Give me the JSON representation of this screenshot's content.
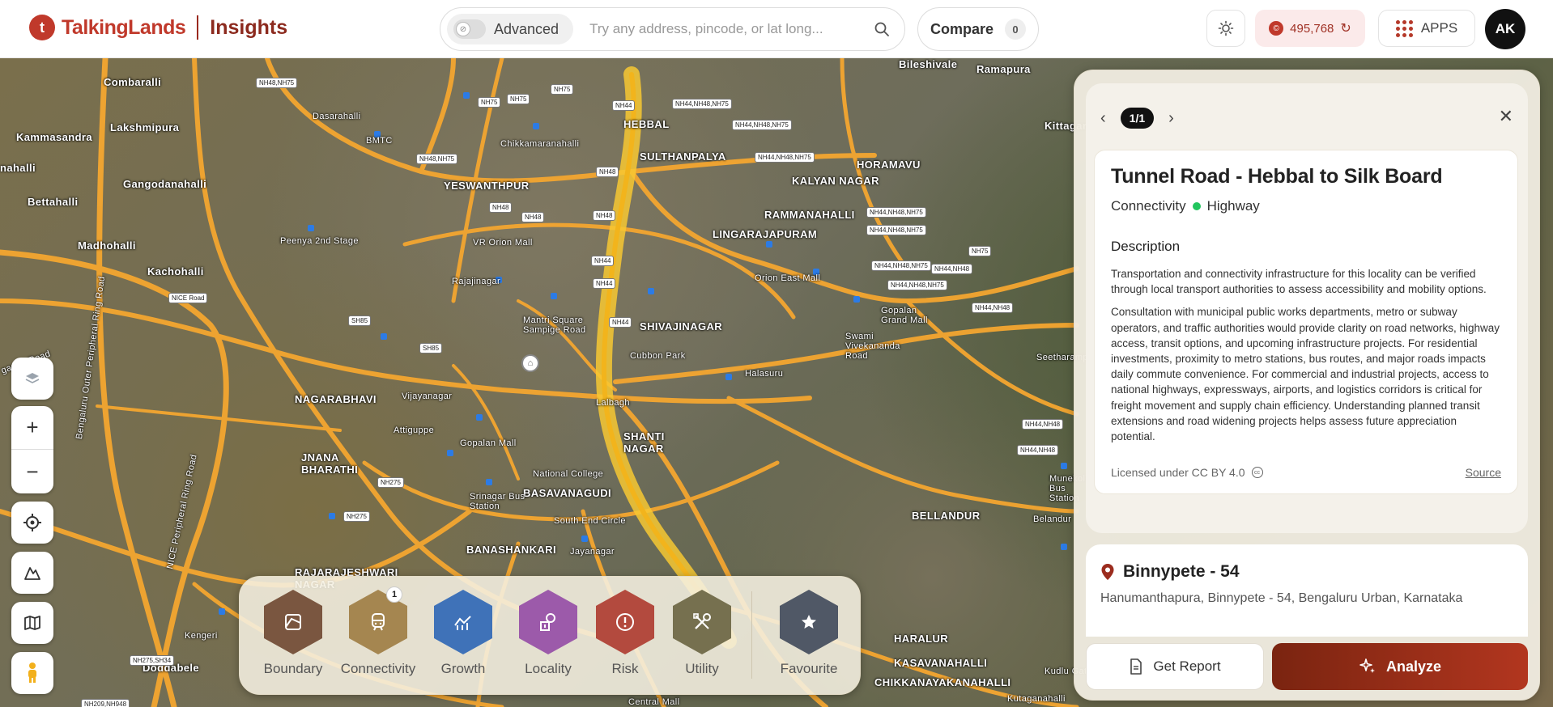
{
  "header": {
    "logo_mark": "t",
    "logo_text": "TalkingLands",
    "logo_sub": "Insights",
    "advanced_label": "Advanced",
    "search_placeholder": "Try any address, pincode, or lat long...",
    "compare_label": "Compare",
    "compare_count": "0",
    "credits_value": "495,768",
    "apps_label": "APPS",
    "avatar_initials": "AK"
  },
  "colors": {
    "brand": "#c0392b",
    "road": "#f4a630",
    "highlight": "#f7c832",
    "analyze": "#a5321c"
  },
  "map": {
    "places": [
      {
        "name": "Combaralli"
      },
      {
        "name": "Lakshmipura"
      },
      {
        "name": "Kammasandra"
      },
      {
        "name": "nahalli"
      },
      {
        "name": "Gangodanahalli"
      },
      {
        "name": "Bettahalli"
      },
      {
        "name": "Madhohalli"
      },
      {
        "name": "Kachohalli"
      },
      {
        "name": "Dasarahalli"
      },
      {
        "name": "BMTC"
      },
      {
        "name": "Chikkamaranahalli"
      },
      {
        "name": "HEBBAL"
      },
      {
        "name": "SULTHANPALYA"
      },
      {
        "name": "HORAMAVU"
      },
      {
        "name": "KALYAN NAGAR"
      },
      {
        "name": "RAMMANAHALLI"
      },
      {
        "name": "LINGARAJAPURAM"
      },
      {
        "name": "YESWANTHPUR"
      },
      {
        "name": "Peenya 2nd Stage"
      },
      {
        "name": "VR Orion Mall"
      },
      {
        "name": "Rajajinagar"
      },
      {
        "name": "Mantri Square Sampige Road"
      },
      {
        "name": "SHIVAJINAGAR"
      },
      {
        "name": "Cubbon Park"
      },
      {
        "name": "Orion East Mall"
      },
      {
        "name": "Gopalan Grand Mall"
      },
      {
        "name": "Swami Vivekananda Road"
      },
      {
        "name": "Halasuru"
      },
      {
        "name": "NAGARABHAVI"
      },
      {
        "name": "Vijayanagar"
      },
      {
        "name": "Attiguppe"
      },
      {
        "name": "Gopalan Mall"
      },
      {
        "name": "National College"
      },
      {
        "name": "JNANA BHARATHI"
      },
      {
        "name": "BASAVANAGUDI"
      },
      {
        "name": "Srinagar Bus Station"
      },
      {
        "name": "South End Circle"
      },
      {
        "name": "BANASHANKARI"
      },
      {
        "name": "RAJARAJESHWARI NAGAR"
      },
      {
        "name": "SHANTI NAGAR"
      },
      {
        "name": "BELLANDUR"
      },
      {
        "name": "HARALUR"
      },
      {
        "name": "KASAVANAHALLI"
      },
      {
        "name": "CHIKKANAYAKANAHALLI"
      },
      {
        "name": "Kengeri"
      },
      {
        "name": "Doddabele"
      },
      {
        "name": "Bileshivale"
      },
      {
        "name": "Ramapura"
      },
      {
        "name": "Kittaganur"
      },
      {
        "name": "Seetharampalya"
      },
      {
        "name": "Munekolala Bus Station"
      },
      {
        "name": "Belandur"
      },
      {
        "name": "Kudlu Gate"
      },
      {
        "name": "Kutaganahalli"
      },
      {
        "name": "Bengaluru Outer Peripheral Ring Road"
      },
      {
        "name": "NICE Peripheral Ring Road"
      },
      {
        "name": "ganga Road"
      },
      {
        "name": "NICE Road"
      },
      {
        "name": "Jayanagar"
      },
      {
        "name": "Central Mall"
      },
      {
        "name": "Lalbagh"
      }
    ],
    "road_tags": [
      "NH48,NH75",
      "NH75",
      "NH75",
      "NH75",
      "NH44",
      "NH44,NH48,NH75",
      "NH44,NH48,NH75",
      "NH48,NH75",
      "NH48",
      "NH44,NH48,NH75",
      "NH48",
      "NH48",
      "NH48",
      "NH44,NH48,NH75",
      "NH44,NH48,NH75",
      "NH44",
      "NH44",
      "NH44,NH48,NH75",
      "NH44,NH48",
      "NH75",
      "NH44,NH48,NH75",
      "NH44,NH48",
      "NH44",
      "SH85",
      "SH85",
      "NH44,NH48",
      "NH44,NH48",
      "NH275",
      "NH275",
      "NH275,SH34",
      "NH209,NH948"
    ]
  },
  "dock": {
    "items": [
      {
        "label": "Boundary",
        "icon": "boundary-icon",
        "color": "#7a5640"
      },
      {
        "label": "Connectivity",
        "icon": "train-icon",
        "color": "#a58650",
        "badge": "1"
      },
      {
        "label": "Growth",
        "icon": "growth-chart-icon",
        "color": "#3f72b8"
      },
      {
        "label": "Locality",
        "icon": "locality-icon",
        "color": "#9c5aaa"
      },
      {
        "label": "Risk",
        "icon": "risk-alert-icon",
        "color": "#b34a3e"
      },
      {
        "label": "Utility",
        "icon": "tools-icon",
        "color": "#76704f"
      },
      {
        "label": "Favourite",
        "icon": "star-icon",
        "color": "#505866"
      }
    ]
  },
  "panel": {
    "pager": "1/1",
    "title": "Tunnel Road - Hebbal to Silk Board",
    "category": "Connectivity",
    "subcategory": "Highway",
    "description_heading": "Description",
    "description_p1": "Transportation and connectivity infrastructure for this locality can be verified through local transport authorities to assess accessibility and mobility options.",
    "description_p2": "Consultation with municipal public works departments, metro or subway operators, and traffic authorities would provide clarity on road networks, highway access, transit options, and upcoming infrastructure projects. For residential investments, proximity to metro stations, bus routes, and major roads impacts daily commute convenience. For commercial and industrial projects, access to national highways, expressways, airports, and logistics corridors is critical for freight movement and supply chain efficiency. Understanding planned transit extensions and road widening projects helps assess future appreciation potential.",
    "license": "Licensed under CC BY 4.0",
    "source": "Source",
    "location_title": "Binnypete - 54",
    "location_address": "Hanumanthapura, Binnypete - 54, Bengaluru Urban, Karnataka",
    "report_label": "Get Report",
    "analyze_label": "Analyze"
  }
}
